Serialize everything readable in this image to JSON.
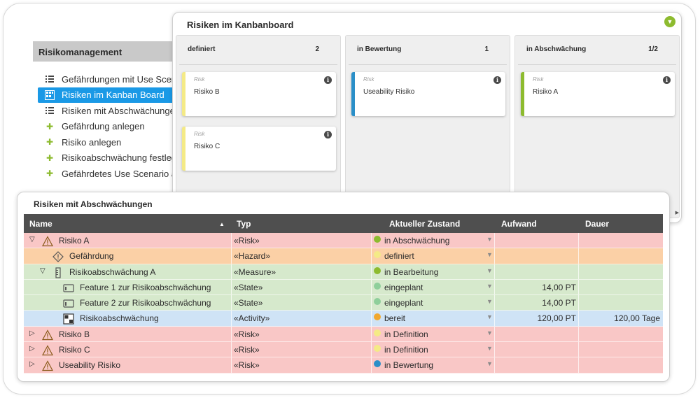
{
  "sidebar": {
    "header": "Risikomanagement",
    "items": [
      {
        "label": "Gefährdungen mit Use Scenarios",
        "icon": "list-icon",
        "active": false
      },
      {
        "label": "Risiken im Kanban Board",
        "icon": "kanban-icon",
        "active": true
      },
      {
        "label": "Risiken mit Abschwächungen",
        "icon": "list-icon",
        "active": false
      },
      {
        "label": "Gefährdung anlegen",
        "icon": "plus-icon",
        "active": false
      },
      {
        "label": "Risiko anlegen",
        "icon": "plus-icon",
        "active": false
      },
      {
        "label": "Risikoabschwächung festlegen",
        "icon": "plus-icon",
        "active": false
      },
      {
        "label": "Gefährdetes Use Scenario anlegen",
        "icon": "plus-icon",
        "active": false
      }
    ]
  },
  "kanban": {
    "title": "Risiken im Kanbanboard",
    "filter_icon": "filter-icon",
    "columns": [
      {
        "name": "definiert",
        "count": "2",
        "cards": [
          {
            "type": "Risk",
            "title": "Risiko B",
            "color": "#f4ea86"
          },
          {
            "type": "Risk",
            "title": "Risiko C",
            "color": "#f4ea86"
          }
        ]
      },
      {
        "name": "in Bewertung",
        "count": "1",
        "cards": [
          {
            "type": "Risk",
            "title": "Useability Risiko",
            "color": "#2a8fc8"
          }
        ]
      },
      {
        "name": "in Abschwächung",
        "count": "1/2",
        "cards": [
          {
            "type": "Risk",
            "title": "Risiko A",
            "color": "#8dbb2f"
          }
        ]
      }
    ]
  },
  "table": {
    "title": "Risiken mit Abschwächungen",
    "headers": {
      "name": "Name",
      "typ": "Typ",
      "zustand": "Aktueller Zustand",
      "aufwand": "Aufwand",
      "dauer": "Dauer"
    },
    "rows": [
      {
        "name": "Risiko A",
        "typ": "«Risk»",
        "zustand": "in Abschwächung",
        "dot": "#8dbb2f",
        "aufwand": "",
        "dauer": "",
        "row_color": "red",
        "indent": 0,
        "expander": "▽",
        "icon": "warning-icon"
      },
      {
        "name": "Gefährdung",
        "typ": "«Hazard»",
        "zustand": "definiert",
        "dot": "#f4ea86",
        "aufwand": "",
        "dauer": "",
        "row_color": "orange",
        "indent": 1,
        "expander": "",
        "icon": "hazard-icon"
      },
      {
        "name": "Risikoabschwächung A",
        "typ": "«Measure»",
        "zustand": "in Bearbeitung",
        "dot": "#8dbb2f",
        "aufwand": "",
        "dauer": "",
        "row_color": "green",
        "indent": 1,
        "expander": "▽",
        "icon": "measure-icon"
      },
      {
        "name": "Feature 1 zur Risikoabschwächung",
        "typ": "«State»",
        "zustand": "eingeplant",
        "dot": "#8fcf9b",
        "aufwand": "14,00 PT",
        "dauer": "",
        "row_color": "green",
        "indent": 2,
        "expander": "",
        "icon": "state-icon"
      },
      {
        "name": "Feature 2 zur Risikoabschwächung",
        "typ": "«State»",
        "zustand": "eingeplant",
        "dot": "#8fcf9b",
        "aufwand": "14,00 PT",
        "dauer": "",
        "row_color": "green",
        "indent": 2,
        "expander": "",
        "icon": "state-icon"
      },
      {
        "name": "Risikoabschwächung",
        "typ": "«Activity»",
        "zustand": "bereit",
        "dot": "#f0a830",
        "aufwand": "120,00 PT",
        "dauer": "120,00 Tage",
        "row_color": "blue",
        "indent": 2,
        "expander": "",
        "icon": "activity-icon"
      },
      {
        "name": "Risiko B",
        "typ": "«Risk»",
        "zustand": "in Definition",
        "dot": "#f4ea86",
        "aufwand": "",
        "dauer": "",
        "row_color": "red",
        "indent": 0,
        "expander": "▷",
        "icon": "warning-icon"
      },
      {
        "name": "Risiko C",
        "typ": "«Risk»",
        "zustand": "in Definition",
        "dot": "#f4ea86",
        "aufwand": "",
        "dauer": "",
        "row_color": "red",
        "indent": 0,
        "expander": "▷",
        "icon": "warning-icon"
      },
      {
        "name": "Useability Risiko",
        "typ": "«Risk»",
        "zustand": "in Bewertung",
        "dot": "#2a8fc8",
        "aufwand": "",
        "dauer": "",
        "row_color": "red",
        "indent": 0,
        "expander": "▷",
        "icon": "warning-icon"
      }
    ]
  }
}
